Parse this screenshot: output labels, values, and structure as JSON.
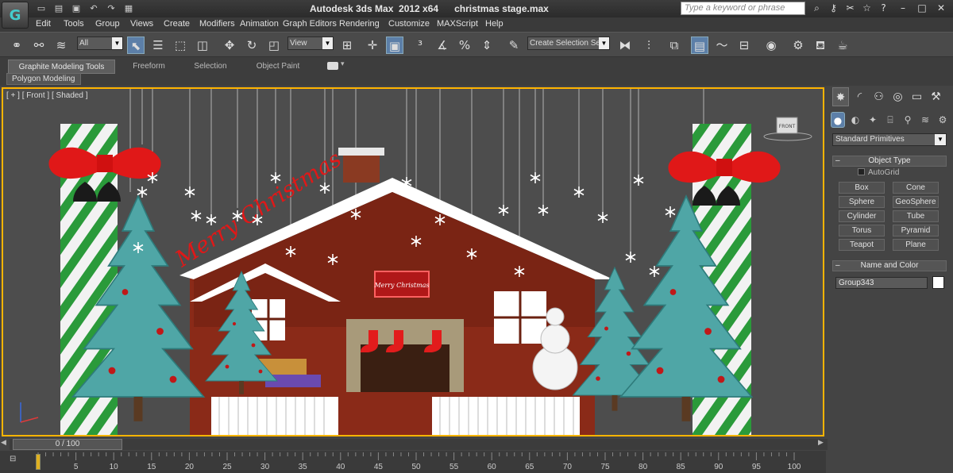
{
  "window": {
    "app_title": "Autodesk 3ds Max  2012 x64",
    "file_name": "christmas stage.max",
    "search_placeholder": "Type a keyword or phrase",
    "logo_glyph": "G"
  },
  "quick_access": [
    "new-icon",
    "open-icon",
    "save-icon",
    "undo-icon",
    "redo-icon",
    "project-icon"
  ],
  "menus": [
    "Edit",
    "Tools",
    "Group",
    "Views",
    "Create",
    "Modifiers",
    "Animation",
    "Graph Editors",
    "Rendering",
    "Customize",
    "MAXScript",
    "Help"
  ],
  "toolbar": {
    "selection_filter": "All",
    "reference_coord": "View",
    "named_selection": "Create Selection Se"
  },
  "ribbon": {
    "tabs": [
      "Graphite Modeling Tools",
      "Freeform",
      "Selection",
      "Object Paint"
    ],
    "active_tab": 0,
    "panel_tab": "Polygon Modeling"
  },
  "viewport": {
    "label": "[ + ] [ Front ] [ Shaded ]",
    "viewcube_label": "FRONT",
    "scene_text": "Merry Christmas",
    "sign_text": "Merry Christmas",
    "border_color": "#ffb400"
  },
  "command_panel": {
    "tabs": [
      "create-tab",
      "modify-tab",
      "hierarchy-tab",
      "motion-tab",
      "display-tab",
      "utilities-tab"
    ],
    "subtabs": [
      "geometry-icon",
      "shapes-icon",
      "lights-icon",
      "cameras-icon",
      "helpers-icon",
      "spacewarps-icon",
      "systems-icon"
    ],
    "category": "Standard Primitives",
    "object_type_header": "Object Type",
    "autogrid_label": "AutoGrid",
    "primitives": [
      "Box",
      "Cone",
      "Sphere",
      "GeoSphere",
      "Cylinder",
      "Tube",
      "Torus",
      "Pyramid",
      "Teapot",
      "Plane"
    ],
    "name_color_header": "Name and Color",
    "object_name": "Group343",
    "object_color": "#ffffff"
  },
  "timeline": {
    "frame_display": "0 / 100",
    "ticks": [
      "5",
      "10",
      "15",
      "20",
      "25",
      "30",
      "35",
      "40",
      "45",
      "50",
      "55",
      "60",
      "65",
      "70",
      "75",
      "80",
      "85",
      "90",
      "95",
      "100"
    ]
  }
}
